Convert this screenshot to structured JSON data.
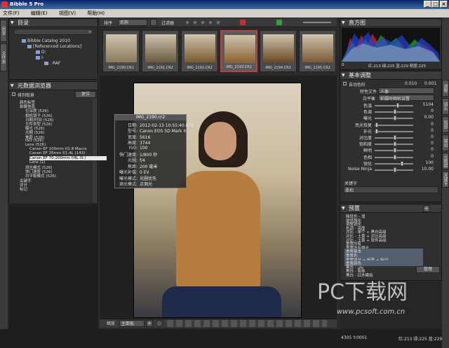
{
  "window": {
    "title": "Bibble 5 Pro",
    "min": "_",
    "max": "□",
    "close": "×"
  },
  "menu": [
    "文件(F)",
    "编辑(E)",
    "视图(V)",
    "帮助(H)"
  ],
  "left_tabs": [
    "目录",
    "文件夹"
  ],
  "catalog": {
    "title": "目录",
    "search_placeholder": "",
    "tree": [
      "Bibble Catalog 2010",
      "[Referenced Locations]",
      "D:",
      "I:",
      ". RAF"
    ]
  },
  "metadata": {
    "title": "元数据浏览器",
    "clear_label": "排列取景",
    "reset_button": "复位",
    "tree": [
      "颜色标签",
      "拍摄信息",
      "位深度 (526)",
      "相机镜子 (526)",
      "日期/时间 (526)",
      "文件类型 (526)",
      "曝光 (526)",
      "光圈 (526)",
      "焦距 (526)",
      "ISO (526)",
      "Lens (526)",
      "Canon EF 100mm f/2.8 Macro",
      "Canon EF 35mm f/1.4L (143)",
      "Canon EF 70-200mm f/4L IS (",
      "Lens (1)",
      "测光模式 (526)",
      "快门速度 (526)",
      "白平衡模式 (526)",
      "关键字",
      "评分",
      "标记"
    ]
  },
  "filmstrip": {
    "sort_label": "排序",
    "sort_value": "名称",
    "filter_label": "过滤器",
    "thumbs": [
      "IMG_2190.CR2",
      "IMG_2191.CR2",
      "IMG_2192.CR2",
      "IMG_2193.CR2",
      "IMG_2194.CR2",
      "IMG_2195.CR2"
    ]
  },
  "overlay": {
    "filename": "IMG_2190.cr2",
    "rows": [
      [
        "日期:",
        "2012-02-13 10:55:40.870"
      ],
      [
        "型号:",
        "Canon EOS 5D Mark II"
      ],
      [
        "宽度:",
        "5616"
      ],
      [
        "高度:",
        "3744"
      ],
      [
        "ISO:",
        "100"
      ],
      [
        "快门速度:",
        "1/800 秒"
      ],
      [
        "光圈:",
        "f/4"
      ],
      [
        "焦距:",
        "200 毫米"
      ],
      [
        "曝光补偿:",
        "0 EV"
      ],
      [
        "曝光模式:",
        "光圈优先"
      ],
      [
        "测光模式:",
        "点测光"
      ]
    ]
  },
  "right_tabs": [
    "调整",
    "镜头",
    "局部",
    "输出",
    "元数据",
    "关键字"
  ],
  "histogram": {
    "title": "直方图",
    "readout": "红:213 绿:225 蓝:229 明度:225",
    "zero": "0"
  },
  "basic": {
    "title": "基本调整",
    "auto_color": "自动色阶",
    "auto_v1": "0.010",
    "auto_v2": "0.001",
    "profile_label": "特性文件",
    "profile_value": "人像",
    "wb_label": "白平衡",
    "wb_value": "拍摄时相机设置",
    "sliders": [
      [
        "色温",
        "5104"
      ],
      [
        "色调",
        "0"
      ],
      [
        "曝光",
        "0.00"
      ],
      [
        "亮光恢复",
        "0"
      ],
      [
        "补光",
        "0"
      ],
      [
        "对比度",
        "0"
      ],
      [
        "饱和度",
        "0"
      ],
      [
        "鲜明",
        "0"
      ],
      [
        "色相",
        "0"
      ],
      [
        "锐化",
        "100"
      ],
      [
        "Noise Ninja",
        "10.00"
      ]
    ],
    "off_label": "关键字",
    "note": "柔和"
  },
  "presets": {
    "title": "预置",
    "items": [
      "降低色 - 增",
      "提供强化",
      "调整锐化",
      "色调 - 亮度",
      "对比 - 单个 + 黑白高级",
      "对比 - 土黄 + 对比高级",
      "对比 - 土黄 + 软件高级",
      "重置所有",
      "重置所有曝光",
      "重置基本",
      "重置色",
      "重置评分 + 标签 + 标记",
      "重置颜色",
      "黑白 - ufo",
      "黑白 - 简单",
      "黑白 - 红外模拟"
    ],
    "apply_button": "管理"
  },
  "bottom": {
    "zoom_label": "缩放",
    "zoom_value": "主面板",
    "coords": "4305 Y:0001",
    "readout2": "红:213 绿:225 蓝:229"
  },
  "watermark": {
    "text": "PC下载网",
    "url": "www.pcsoft.com.cn"
  },
  "colors": {
    "accent": "#c04040",
    "titlebar": "#0a246a"
  }
}
